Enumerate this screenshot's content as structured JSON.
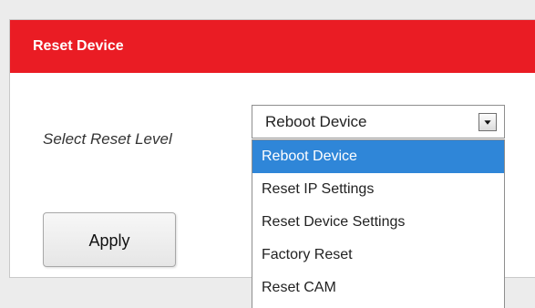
{
  "panel": {
    "title": "Reset Device"
  },
  "form": {
    "label": "Select Reset Level",
    "selected_value": "Reboot Device",
    "options": [
      "Reboot Device",
      "Reset IP Settings",
      "Reset Device Settings",
      "Factory Reset",
      "Reset CAM"
    ]
  },
  "actions": {
    "apply_label": "Apply"
  },
  "icons": {
    "dropdown_arrow": "chevron-down-icon"
  },
  "colors": {
    "header_bg": "#ea1c24",
    "selected_bg": "#2f86d8",
    "page_bg": "#ececec",
    "panel_bg": "#ffffff"
  }
}
